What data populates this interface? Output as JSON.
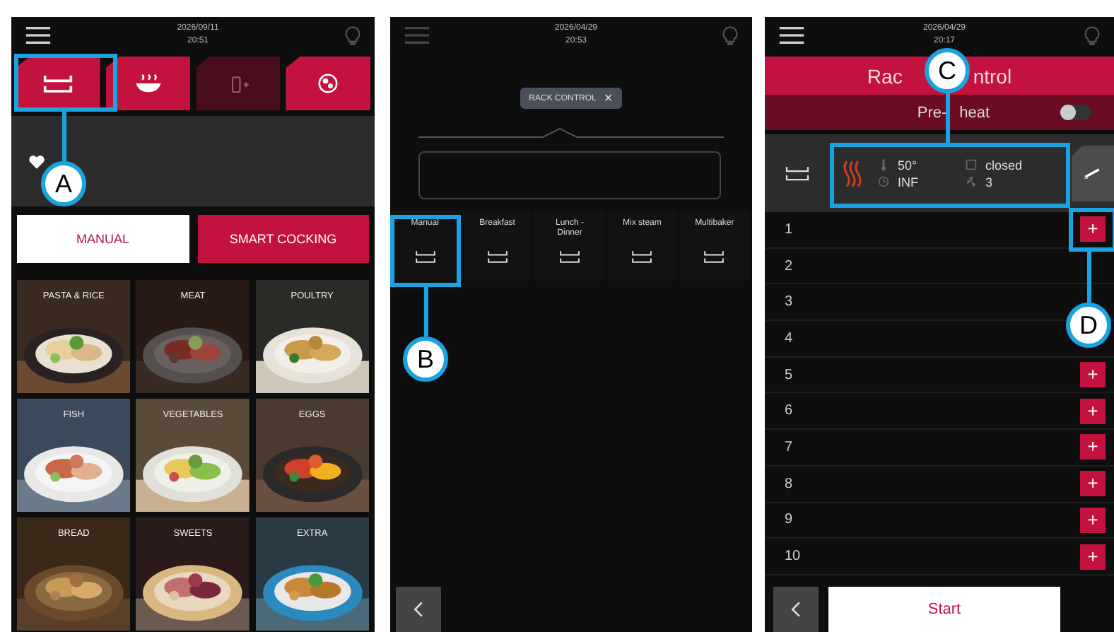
{
  "left_screen": {
    "status": {
      "date": "2026/09/11",
      "time": "20:51"
    },
    "tabs": [
      {
        "kind": "rack",
        "disabled": false
      },
      {
        "kind": "steam",
        "disabled": false
      },
      {
        "kind": "bottle",
        "disabled": true
      },
      {
        "kind": "dial",
        "disabled": false
      }
    ],
    "modes": [
      {
        "label": "MANUAL",
        "selected": true
      },
      {
        "label": "SMART COCKING",
        "selected": false
      }
    ],
    "categories": [
      {
        "label": "PASTA & RICE",
        "kind": "picture"
      },
      {
        "label": "MEAT",
        "kind": "picture"
      },
      {
        "label": "POULTRY",
        "kind": "picture"
      },
      {
        "label": "FISH",
        "kind": "picture"
      },
      {
        "label": "VEGETABLES",
        "kind": "picture"
      },
      {
        "label": "EGGS",
        "kind": "picture"
      },
      {
        "label": "BREAD",
        "kind": "picture"
      },
      {
        "label": "SWEETS",
        "kind": "picture"
      },
      {
        "label": "EXTRA",
        "kind": "picture"
      }
    ]
  },
  "middle_screen": {
    "status": {
      "date": "2026/04/29",
      "time": "20:53"
    },
    "filter_chip": {
      "label": "RACK CONTROL",
      "close": "✕"
    },
    "programs": [
      {
        "label": "Manual"
      },
      {
        "label": "Breakfast"
      },
      {
        "label": "Lunch - Dinner"
      },
      {
        "label": "Mix steam"
      },
      {
        "label": "Multibaker"
      }
    ]
  },
  "right_screen": {
    "status": {
      "date": "2026/04/29",
      "time": "20:17"
    },
    "title_parts": [
      "Rac",
      "ntrol"
    ],
    "preheat": {
      "label_parts": [
        "Pre-",
        "heat"
      ],
      "on": false
    },
    "settings": {
      "temperature": "50°",
      "time": "INF",
      "door": "closed",
      "fan": "3"
    },
    "racks": [
      {
        "number": "1",
        "add": "+"
      },
      {
        "number": "2"
      },
      {
        "number": "3"
      },
      {
        "number": "4"
      },
      {
        "number": "5",
        "add": "+"
      },
      {
        "number": "6",
        "add": "+"
      },
      {
        "number": "7",
        "add": "+"
      },
      {
        "number": "8",
        "add": "+"
      },
      {
        "number": "9",
        "add": "+"
      },
      {
        "number": "10",
        "add": "+"
      }
    ],
    "start_button": "Start"
  },
  "callouts": [
    {
      "label": "A"
    },
    {
      "label": "B"
    },
    {
      "label": "C"
    },
    {
      "label": "D"
    }
  ]
}
